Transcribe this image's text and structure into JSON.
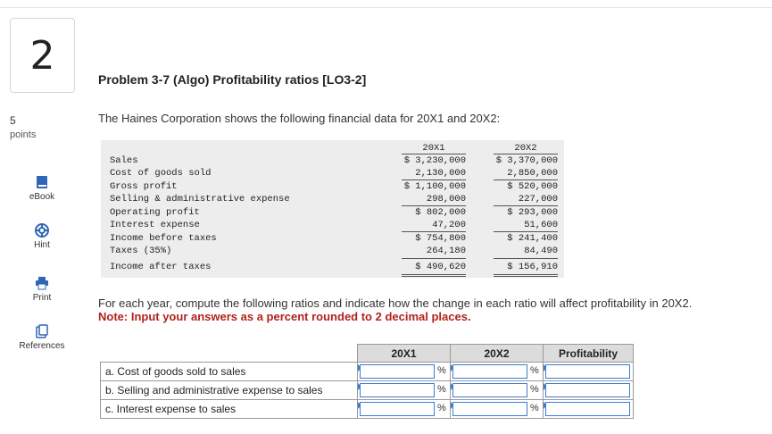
{
  "question": {
    "number": "2",
    "points": "5",
    "points_label": "points"
  },
  "rail": {
    "ebook": "eBook",
    "hint": "Hint",
    "print": "Print",
    "references": "References"
  },
  "problem": {
    "title": "Problem 3-7 (Algo) Profitability ratios [LO3-2]",
    "intro": "The Haines Corporation shows the following financial data for 20X1 and 20X2:"
  },
  "financial": {
    "col1": "20X1",
    "col2": "20X2",
    "rows": [
      {
        "label": "Sales",
        "v1": "$ 3,230,000",
        "v2": "$ 3,370,000"
      },
      {
        "label": "Cost of goods sold",
        "v1": "2,130,000",
        "v2": "2,850,000"
      },
      {
        "label": "Gross profit",
        "v1": "$ 1,100,000",
        "v2": "$ 520,000"
      },
      {
        "label": "Selling & administrative expense",
        "v1": "298,000",
        "v2": "227,000"
      },
      {
        "label": "Operating profit",
        "v1": "$ 802,000",
        "v2": "$ 293,000"
      },
      {
        "label": "Interest expense",
        "v1": "47,200",
        "v2": "51,600"
      },
      {
        "label": "Income before taxes",
        "v1": "$ 754,800",
        "v2": "$ 241,400"
      },
      {
        "label": "Taxes (35%)",
        "v1": "264,180",
        "v2": "84,490"
      },
      {
        "label": "Income after taxes",
        "v1": "$ 490,620",
        "v2": "$ 156,910"
      }
    ]
  },
  "instructions": {
    "text": "For each year, compute the following ratios and indicate how the change in each ratio will affect profitability in 20X2.",
    "note": "Note: Input your answers as a percent rounded to 2 decimal places."
  },
  "answer_table": {
    "headers": [
      "20X1",
      "20X2",
      "Profitability"
    ],
    "percent_sign": "%",
    "rows": [
      {
        "label": "a. Cost of goods sold to sales",
        "v1": "",
        "v2": "",
        "profitability": ""
      },
      {
        "label": "b. Selling and administrative expense to sales",
        "v1": "",
        "v2": "",
        "profitability": ""
      },
      {
        "label": "c. Interest expense to sales",
        "v1": "",
        "v2": "",
        "profitability": ""
      }
    ]
  },
  "colors": {
    "accent": "#3e7bd1",
    "note_red": "#b0231d",
    "data_bg": "#ededed",
    "header_bg": "#dcdcdc"
  }
}
